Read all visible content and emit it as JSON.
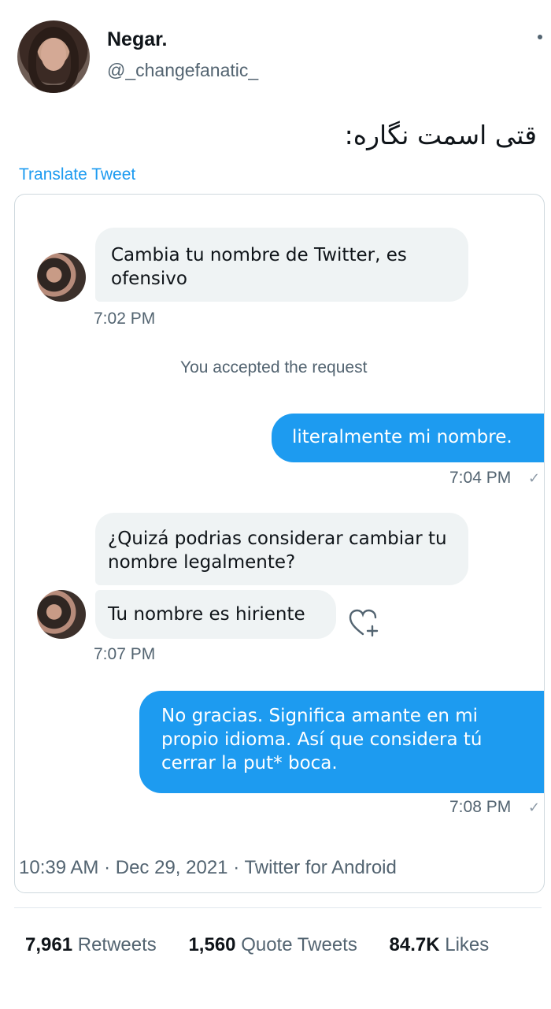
{
  "author": {
    "display_name": "Negar.",
    "handle": "@_changefanatic_"
  },
  "tweet": {
    "text": "قتی اسمت نگاره:",
    "translate_label": "Translate Tweet"
  },
  "dm": {
    "messages": [
      {
        "text": "Cambia tu nombre de Twitter, es ofensivo",
        "time": "7:02 PM"
      },
      {
        "system": "You accepted the request"
      },
      {
        "text": "literalmente mi nombre.",
        "time": "7:04 PM"
      },
      {
        "text": "¿Quizá podrias considerar cambiar tu nombre legalmente?"
      },
      {
        "text": "Tu nombre es hiriente",
        "time": "7:07 PM"
      },
      {
        "text": "No gracias. Significa amante en mi propio idioma. Así que considera tú cerrar la put* boca.",
        "time": "7:08 PM"
      }
    ],
    "check_glyph": "✓"
  },
  "meta": {
    "time": "10:39 AM",
    "date": "Dec 29, 2021",
    "source": "Twitter for Android",
    "sep": "·"
  },
  "stats": {
    "retweets_count": "7,961",
    "retweets_label": "Retweets",
    "quotes_count": "1,560",
    "quotes_label": "Quote Tweets",
    "likes_count": "84.7K",
    "likes_label": "Likes"
  },
  "colors": {
    "accent": "#1d9bf0",
    "incoming_bubble": "#eff3f4",
    "muted_text": "#536471"
  }
}
